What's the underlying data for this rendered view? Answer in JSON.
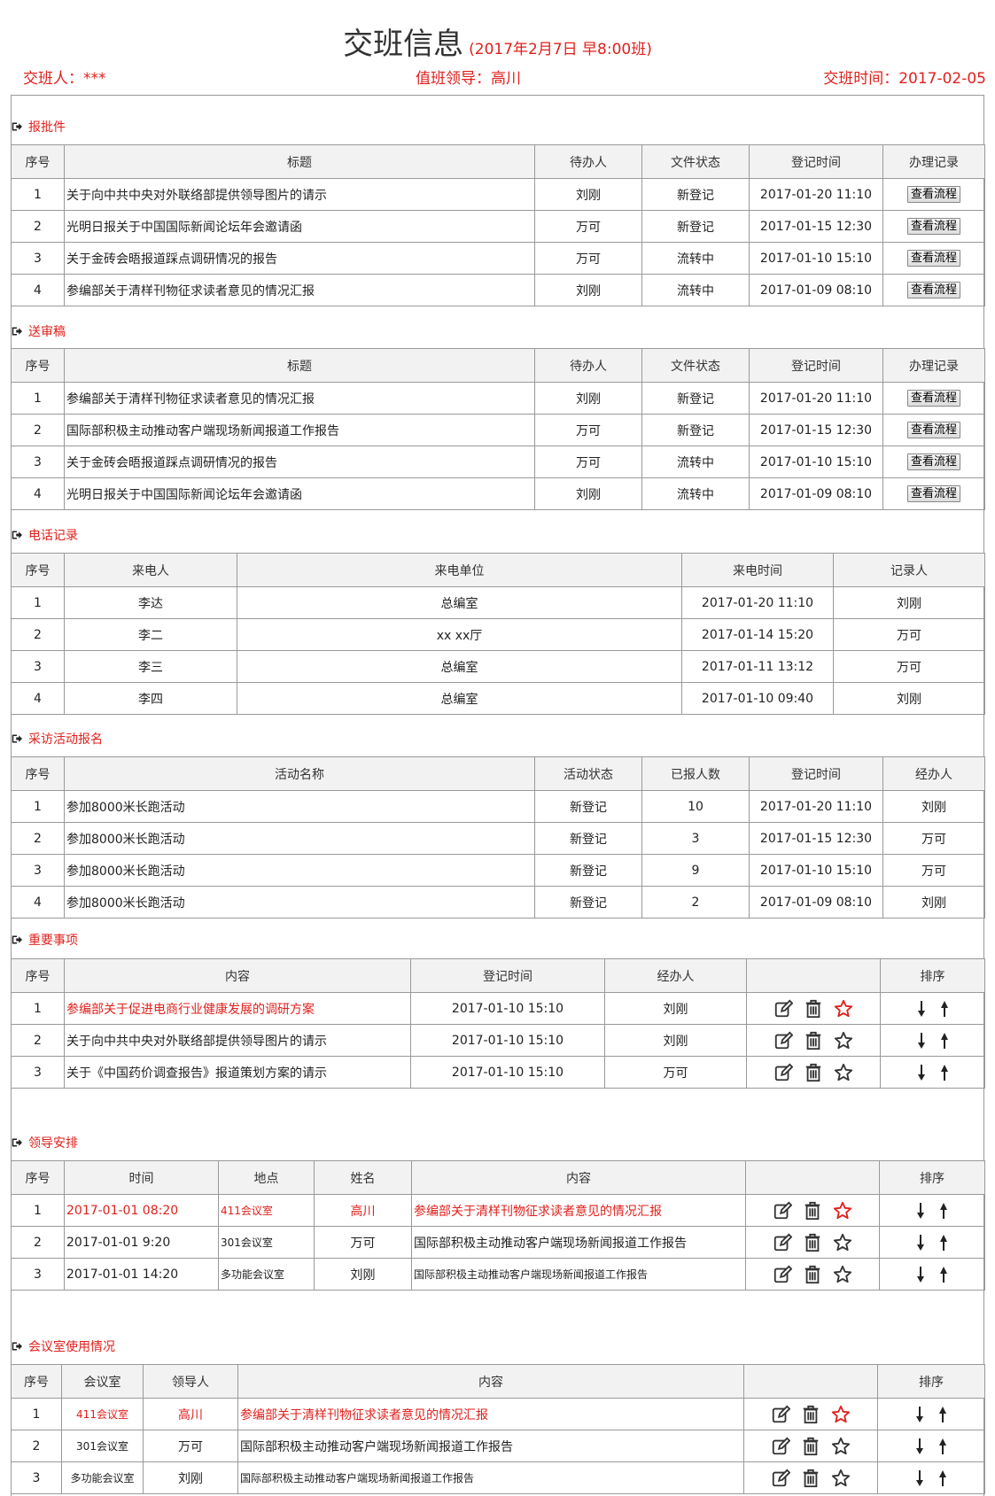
{
  "header": {
    "title": "交班信息",
    "subtitle": "(2017年2月7日  早8:00班)",
    "handover_person": "交班人：***",
    "duty_leader": "值班领导：高川",
    "handover_time_label": "交班时间：",
    "handover_time": "2017-02-05"
  },
  "approval": {
    "title": "报批件",
    "columns": [
      "序号",
      "标题",
      "待办人",
      "文件状态",
      "登记时间",
      "办理记录"
    ],
    "button_label": "查看流程",
    "rows": [
      {
        "no": "1",
        "title": "关于向中共中央对外联络部提供领导图片的请示",
        "person": "刘刚",
        "status": "新登记",
        "time": "2017-01-20  11:10"
      },
      {
        "no": "2",
        "title": "光明日报关于中国国际新闻论坛年会邀请函",
        "person": "万可",
        "status": "新登记",
        "time": "2017-01-15  12:30"
      },
      {
        "no": "3",
        "title": "关于金砖会晤报道踩点调研情况的报告",
        "person": "万可",
        "status": "流转中",
        "time": "2017-01-10  15:10"
      },
      {
        "no": "4",
        "title": "参编部关于清样刊物征求读者意见的情况汇报",
        "person": "刘刚",
        "status": "流转中",
        "time": "2017-01-09  08:10"
      }
    ]
  },
  "review": {
    "title": "送审稿",
    "columns": [
      "序号",
      "标题",
      "待办人",
      "文件状态",
      "登记时间",
      "办理记录"
    ],
    "button_label": "查看流程",
    "rows": [
      {
        "no": "1",
        "title": "参编部关于清样刊物征求读者意见的情况汇报",
        "person": "刘刚",
        "status": "新登记",
        "time": "2017-01-20  11:10"
      },
      {
        "no": "2",
        "title": "国际部积极主动推动客户端现场新闻报道工作报告",
        "person": "万可",
        "status": "新登记",
        "time": "2017-01-15  12:30"
      },
      {
        "no": "3",
        "title": "关于金砖会晤报道踩点调研情况的报告",
        "person": "万可",
        "status": "流转中",
        "time": "2017-01-10  15:10"
      },
      {
        "no": "4",
        "title": "光明日报关于中国国际新闻论坛年会邀请函",
        "person": "刘刚",
        "status": "流转中",
        "time": "2017-01-09  08:10"
      }
    ]
  },
  "phone": {
    "title": "电话记录",
    "columns": [
      "序号",
      "来电人",
      "来电单位",
      "来电时间",
      "记录人"
    ],
    "rows": [
      {
        "no": "1",
        "caller": "李达",
        "unit": "总编室",
        "time": "2017-01-20  11:10",
        "recorder": "刘刚"
      },
      {
        "no": "2",
        "caller": "李二",
        "unit": "xx xx厅",
        "time": "2017-01-14  15:20",
        "recorder": "万可"
      },
      {
        "no": "3",
        "caller": "李三",
        "unit": "总编室",
        "time": "2017-01-11  13:12",
        "recorder": "万可"
      },
      {
        "no": "4",
        "caller": "李四",
        "unit": "总编室",
        "time": "2017-01-10  09:40",
        "recorder": "刘刚"
      }
    ]
  },
  "interview": {
    "title": "采访活动报名",
    "columns": [
      "序号",
      "活动名称",
      "活动状态",
      "已报人数",
      "登记时间",
      "经办人"
    ],
    "rows": [
      {
        "no": "1",
        "name": "参加8000米长跑活动",
        "status": "新登记",
        "count": "10",
        "time": "2017-01-20  11:10",
        "handler": "刘刚"
      },
      {
        "no": "2",
        "name": "参加8000米长跑活动",
        "status": "新登记",
        "count": "3",
        "time": "2017-01-15  12:30",
        "handler": "万可"
      },
      {
        "no": "3",
        "name": "参加8000米长跑活动",
        "status": "新登记",
        "count": "9",
        "time": "2017-01-10  15:10",
        "handler": "万可"
      },
      {
        "no": "4",
        "name": "参加8000米长跑活动",
        "status": "新登记",
        "count": "2",
        "time": "2017-01-09  08:10",
        "handler": "刘刚"
      }
    ]
  },
  "important": {
    "title": "重要事项",
    "columns": [
      "序号",
      "内容",
      "登记时间",
      "经办人",
      "",
      "排序"
    ],
    "rows": [
      {
        "no": "1",
        "content": "参编部关于促进电商行业健康发展的调研方案",
        "time": "2017-01-10  15:10",
        "handler": "刘刚",
        "starred": true
      },
      {
        "no": "2",
        "content": "关于向中共中央对外联络部提供领导图片的请示",
        "time": "2017-01-10  15:10",
        "handler": "刘刚",
        "starred": false
      },
      {
        "no": "3",
        "content": "关于《中国药价调查报告》报道策划方案的请示",
        "time": "2017-01-10  15:10",
        "handler": "万可",
        "starred": false
      }
    ]
  },
  "leader": {
    "title": "领导安排",
    "columns": [
      "序号",
      "时间",
      "地点",
      "姓名",
      "内容",
      "",
      "排序"
    ],
    "rows": [
      {
        "no": "1",
        "time": "2017-01-01 08:20",
        "place": "411会议室",
        "name": "高川",
        "content": "参编部关于清样刊物征求读者意见的情况汇报",
        "starred": true
      },
      {
        "no": "2",
        "time": "2017-01-01 9:20",
        "place": "301会议室",
        "name": "万可",
        "content": "国际部积极主动推动客户端现场新闻报道工作报告",
        "starred": false
      },
      {
        "no": "3",
        "time": "2017-01-01 14:20",
        "place": "多功能会议室",
        "name": "刘刚",
        "content": "国际部积极主动推动客户端现场新闻报道工作报告",
        "starred": false
      }
    ]
  },
  "meeting": {
    "title": "会议室使用情况",
    "columns": [
      "序号",
      "会议室",
      "领导人",
      "内容",
      "",
      "排序"
    ],
    "rows": [
      {
        "no": "1",
        "room": "411会议室",
        "leader": "高川",
        "content": "参编部关于清样刊物征求读者意见的情况汇报",
        "starred": true
      },
      {
        "no": "2",
        "room": "301会议室",
        "leader": "万可",
        "content": "国际部积极主动推动客户端现场新闻报道工作报告",
        "starred": false
      },
      {
        "no": "3",
        "room": "多功能会议室",
        "leader": "刘刚",
        "content": "国际部积极主动推动客户端现场新闻报道工作报告",
        "starred": false
      }
    ]
  },
  "colors": {
    "accent": "#e0201c",
    "header_bg": "#f2f2f2",
    "border": "#999999"
  },
  "icons": [
    "exit-icon",
    "edit-icon",
    "trash-icon",
    "star-icon",
    "arrow-down-icon",
    "arrow-up-icon"
  ]
}
